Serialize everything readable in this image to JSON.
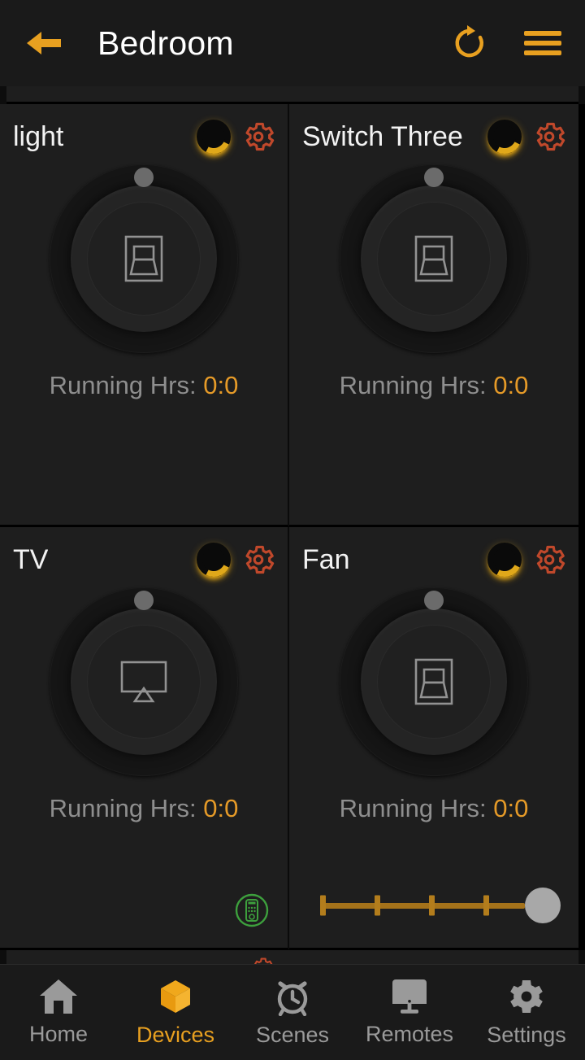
{
  "header": {
    "title": "Bedroom",
    "back_icon": "arrow-left-icon",
    "refresh_icon": "refresh-icon",
    "menu_icon": "hamburger-menu-icon"
  },
  "theme": {
    "accent": "#e8a020",
    "gear": "#c0482b",
    "page_bg": "#151515",
    "card_bg": "#1e1e1e",
    "text": "#f2f2f2",
    "muted": "#8e8e8e",
    "remote_green": "#3da03d",
    "slider": "#b37d1c"
  },
  "devices": [
    {
      "name": "light",
      "power_icon": "power-toggle-icon",
      "settings_icon": "gear-icon",
      "dial_icon": "rocker-switch-icon",
      "hours_label": "Running Hrs:",
      "hours_value": "0:0",
      "extra": "none"
    },
    {
      "name": "Switch Three",
      "power_icon": "power-toggle-icon",
      "settings_icon": "gear-icon",
      "dial_icon": "rocker-switch-icon",
      "hours_label": "Running Hrs:",
      "hours_value": "0:0",
      "extra": "none"
    },
    {
      "name": "TV",
      "power_icon": "power-toggle-icon",
      "settings_icon": "gear-icon",
      "dial_icon": "tv-icon",
      "hours_label": "Running Hrs:",
      "hours_value": "0:0",
      "extra": "remote"
    },
    {
      "name": "Fan",
      "power_icon": "power-toggle-icon",
      "settings_icon": "gear-icon",
      "dial_icon": "rocker-switch-icon",
      "hours_label": "Running Hrs:",
      "hours_value": "0:0",
      "extra": "slider",
      "slider": {
        "ticks": 5,
        "value": 5,
        "max": 5
      }
    }
  ],
  "bottom_nav": {
    "active": "Devices",
    "items": [
      {
        "label": "Home",
        "icon": "home-icon"
      },
      {
        "label": "Devices",
        "icon": "cube-icon"
      },
      {
        "label": "Scenes",
        "icon": "alarm-clock-icon"
      },
      {
        "label": "Remotes",
        "icon": "monitor-icon"
      },
      {
        "label": "Settings",
        "icon": "gear-icon"
      }
    ]
  }
}
